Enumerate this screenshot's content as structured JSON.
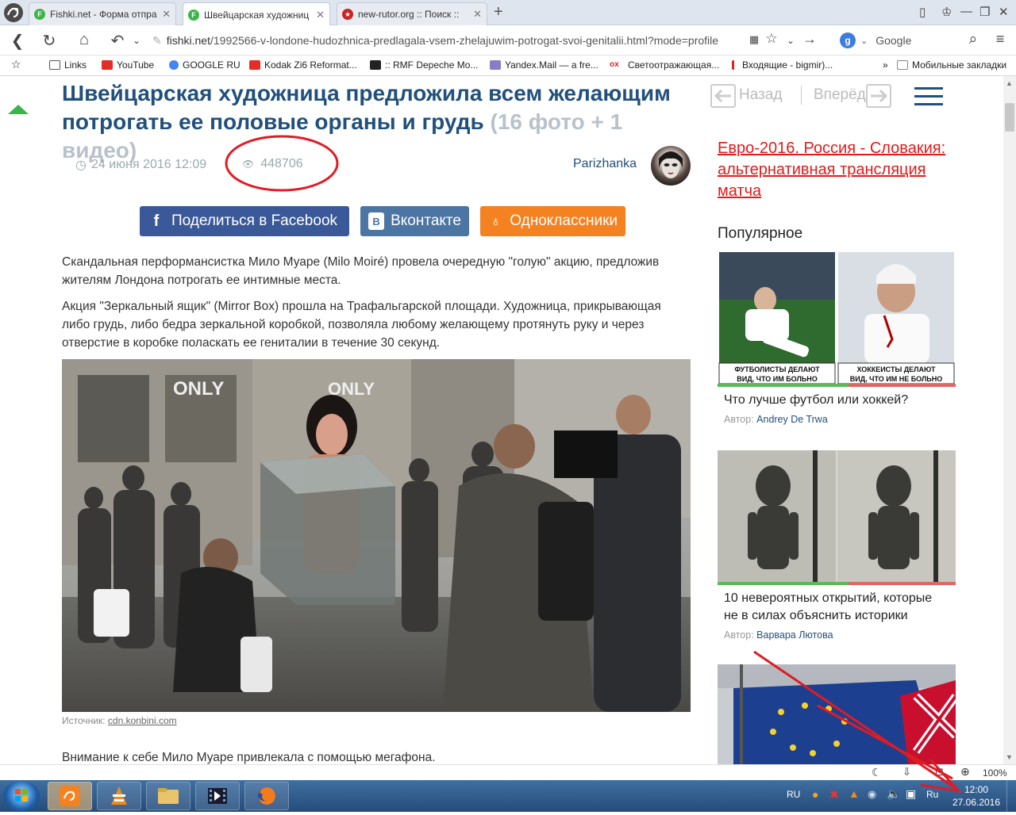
{
  "browser": {
    "tabs": [
      {
        "label": "Fishki.net - Форма отпра",
        "favicon_color": "#3bb54a",
        "favicon_letter": "F",
        "active": false
      },
      {
        "label": "Швейцарская художниц",
        "favicon_color": "#3bb54a",
        "favicon_letter": "F",
        "active": true
      },
      {
        "label": "new-rutor.org :: Поиск ::",
        "favicon_color": "#cc2222",
        "favicon_letter": "",
        "active": false
      }
    ],
    "url_host": "fishki.net",
    "url_path": "/1992566-v-londone-hudozhnica-predlagala-vsem-zhelajuwim-potrogat-svoi-genitalii.html?mode=profile",
    "search_engine": "Google",
    "bookmarks": [
      {
        "label": "Links",
        "icon_color": "#555"
      },
      {
        "label": "YouTube",
        "icon_color": "#e52d27"
      },
      {
        "label": "GOOGLE RU",
        "icon_color": "#4285f4"
      },
      {
        "label": "Kodak Zi6 Reformat...",
        "icon_color": "#e52d27"
      },
      {
        "label": ":: RMF Depeche Mo...",
        "icon_color": "#222"
      },
      {
        "label": "Yandex.Mail — a fre...",
        "icon_color": "#8a7cc8"
      },
      {
        "label": "Светоотражающая...",
        "icon_color": "#d22"
      },
      {
        "label": "Входящие - bigmir)...",
        "icon_color": "#d22"
      },
      {
        "label": "»",
        "icon_color": ""
      },
      {
        "label": "Мобильные закладки",
        "icon_color": "#888"
      }
    ]
  },
  "article": {
    "title_main": "Швейцарская художница предложила всем желающим потрогать ее половые органы и грудь",
    "title_counts": "(16 фото + 1 видео)",
    "date": "24 июня 2016 12:09",
    "views": "448706",
    "author": "Parizhanka",
    "share": {
      "facebook": "Поделиться в Facebook",
      "vk": "Вконтакте",
      "ok": "Одноклассники"
    },
    "para1": "Скандальная перформансистка Мило Муаре (Milo Moiré) провела очередную \"голую\" акцию, предложив жителям Лондона потрогать ее интимные места.",
    "para2": "Акция \"Зеркальный ящик\" (Mirror Box) прошла на Трафальгарской площади. Художница, прикрывающая либо грудь, либо бедра зеркальной коробкой, позволяла любому желающему протянуть руку и через отверстие в коробке поласкать ее гениталии в течение 30 секунд.",
    "photo_source_label": "Источник:",
    "photo_source_link": "cdn.konbini.com",
    "para3": "Внимание к себе Мило Муаре привлекала с помощью мегафона."
  },
  "sidebar": {
    "back_label": "Назад",
    "forward_label": "Вперёд",
    "promo_link": "Евро-2016. Россия - Словакия: альтернативная трансляция матча",
    "popular_heading": "Популярное",
    "cards": [
      {
        "title": "Что лучше футбол или хоккей?",
        "author_label": "Автор:",
        "author": "Andrey De Trwa",
        "caption_left": "ФУТБОЛИСТЫ ДЕЛАЮТ ВИД, ЧТО ИМ БОЛЬНО",
        "caption_right": "ХОККЕИСТЫ ДЕЛАЮТ ВИД, ЧТО ИМ НЕ БОЛЬНО"
      },
      {
        "title": "10 невероятных открытий, которые не в силах объяснить историки",
        "author_label": "Автор:",
        "author": "Варвара Лютова"
      },
      {
        "title": "",
        "author_label": "",
        "author": ""
      }
    ]
  },
  "statusbar": {
    "zoom": "100%"
  },
  "taskbar": {
    "lang": "RU",
    "tray_lang": "Ru",
    "time": "12:00",
    "date": "27.06.2016"
  },
  "colors": {
    "title": "#21507c",
    "accent_green": "#3bb54a",
    "facebook": "#3b5998",
    "vk": "#4c75a3",
    "ok": "#f58220",
    "promo": "#e21a1a",
    "annotation": "#e01b24"
  }
}
